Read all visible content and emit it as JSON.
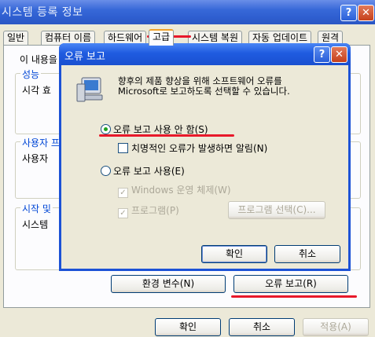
{
  "window": {
    "title": "시스템 등록 정보",
    "help_glyph": "?",
    "close_glyph": "✕"
  },
  "tabs": [
    "일반",
    "컴퓨터 이름",
    "하드웨어",
    "고급",
    "시스템 복원",
    "자동 업데이트",
    "원격"
  ],
  "panel": {
    "intro_text": "이 내용을",
    "group_performance": {
      "label": "성능",
      "text": "시각 효"
    },
    "group_profiles": {
      "label": "사용자 프",
      "text": "사용자"
    },
    "group_startup": {
      "label": "시작 및",
      "text": "시스템"
    },
    "env_button": "환경 변수(N)",
    "error_report_button": "오류 보고(R)"
  },
  "footer": {
    "ok": "확인",
    "cancel": "취소",
    "apply": "적용(A)"
  },
  "dialog": {
    "title": "오류 보고",
    "help_glyph": "?",
    "close_glyph": "✕",
    "description_line1": "향후의 제품 향상을 위해 소프트웨어 오류를",
    "description_line2": "Microsoft로 보고하도록 선택할 수 있습니다.",
    "radio_disable": "오류 보고 사용 안 함(S)",
    "check_notify": "치명적인 오류가 발생하면 알림(N)",
    "radio_enable": "오류 보고 사용(E)",
    "check_windows": "Windows 운영 체제(W)",
    "check_programs": "프로그램(P)",
    "choose_programs_button": "프로그램 선택(C)...",
    "ok": "확인",
    "cancel": "취소",
    "check_mark": "✓"
  }
}
